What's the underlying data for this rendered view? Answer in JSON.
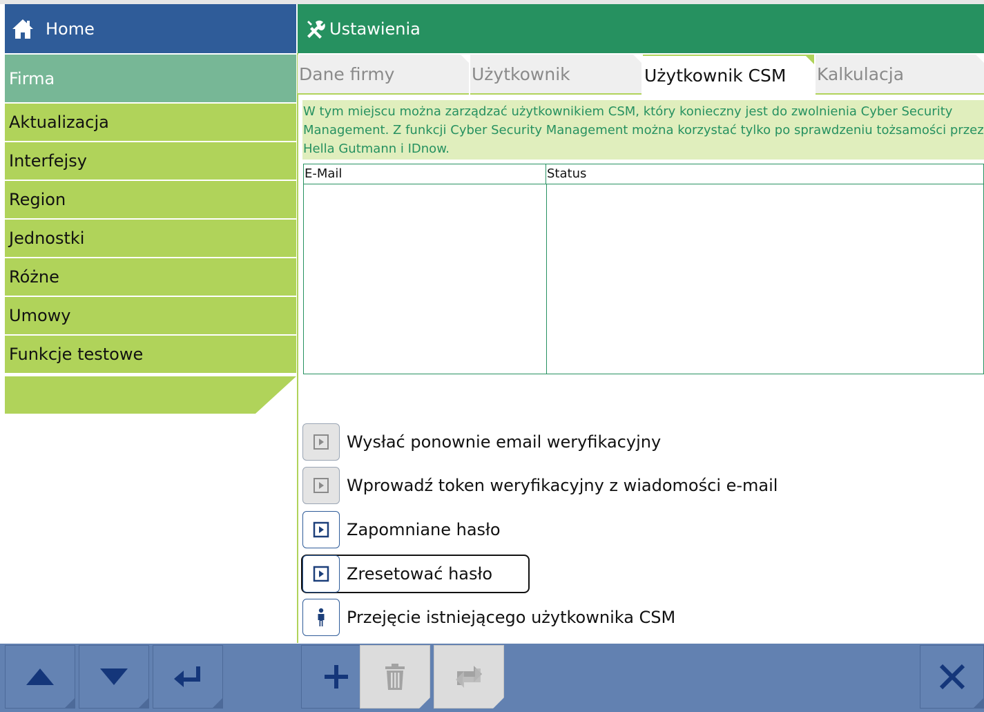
{
  "header": {
    "home_label": "Home",
    "settings_label": "Ustawienia"
  },
  "sidebar": {
    "items": [
      {
        "label": "Firma",
        "active": true
      },
      {
        "label": "Aktualizacja"
      },
      {
        "label": "Interfejsy"
      },
      {
        "label": "Region"
      },
      {
        "label": "Jednostki"
      },
      {
        "label": "Różne"
      },
      {
        "label": "Umowy"
      },
      {
        "label": "Funkcje testowe"
      }
    ]
  },
  "tabs": [
    {
      "label": "Dane firmy"
    },
    {
      "label": "Użytkownik"
    },
    {
      "label": "Użytkownik CSM",
      "active": true
    },
    {
      "label": "Kalkulacja"
    }
  ],
  "info_text": "W tym miejscu można zarządzać użytkownikiem CSM, który konieczny jest do zwolnienia Cyber Security Management. Z funkcji Cyber Security Management można korzystać tylko po sprawdzeniu tożsamości przez Hella Gutmann i IDnow.",
  "table": {
    "columns": [
      "E-Mail",
      "Status"
    ],
    "rows": []
  },
  "actions": [
    {
      "label": "Wysłać ponownie email weryfikacyjny",
      "icon": "play-box-icon",
      "enabled": false
    },
    {
      "label": "Wprowadź token weryfikacyjny z wiadomości e-mail",
      "icon": "play-box-icon",
      "enabled": false
    },
    {
      "label": "Zapomniane hasło",
      "icon": "play-box-icon",
      "enabled": true
    },
    {
      "label": "Zresetować hasło",
      "icon": "play-box-icon",
      "enabled": true,
      "focused": true
    },
    {
      "label": "Przejęcie istniejącego użytkownika CSM",
      "icon": "person-icon",
      "enabled": true
    }
  ],
  "toolbar": {
    "buttons": [
      {
        "name": "up",
        "icon": "arrow-up-icon"
      },
      {
        "name": "down",
        "icon": "arrow-down-icon"
      },
      {
        "name": "enter",
        "icon": "enter-icon"
      },
      {
        "name": "add",
        "icon": "plus-icon"
      },
      {
        "name": "delete",
        "icon": "trash-icon",
        "enabled": false
      },
      {
        "name": "refresh",
        "icon": "refresh-icon",
        "enabled": false
      },
      {
        "name": "close",
        "icon": "close-icon"
      }
    ]
  },
  "colors": {
    "home_blue": "#2f5c99",
    "settings_green": "#269160",
    "sidebar_green": "#b0d35a",
    "active_teal": "#77b796",
    "toolbar_blue": "#6281b1",
    "info_bg": "#e0eebd"
  }
}
